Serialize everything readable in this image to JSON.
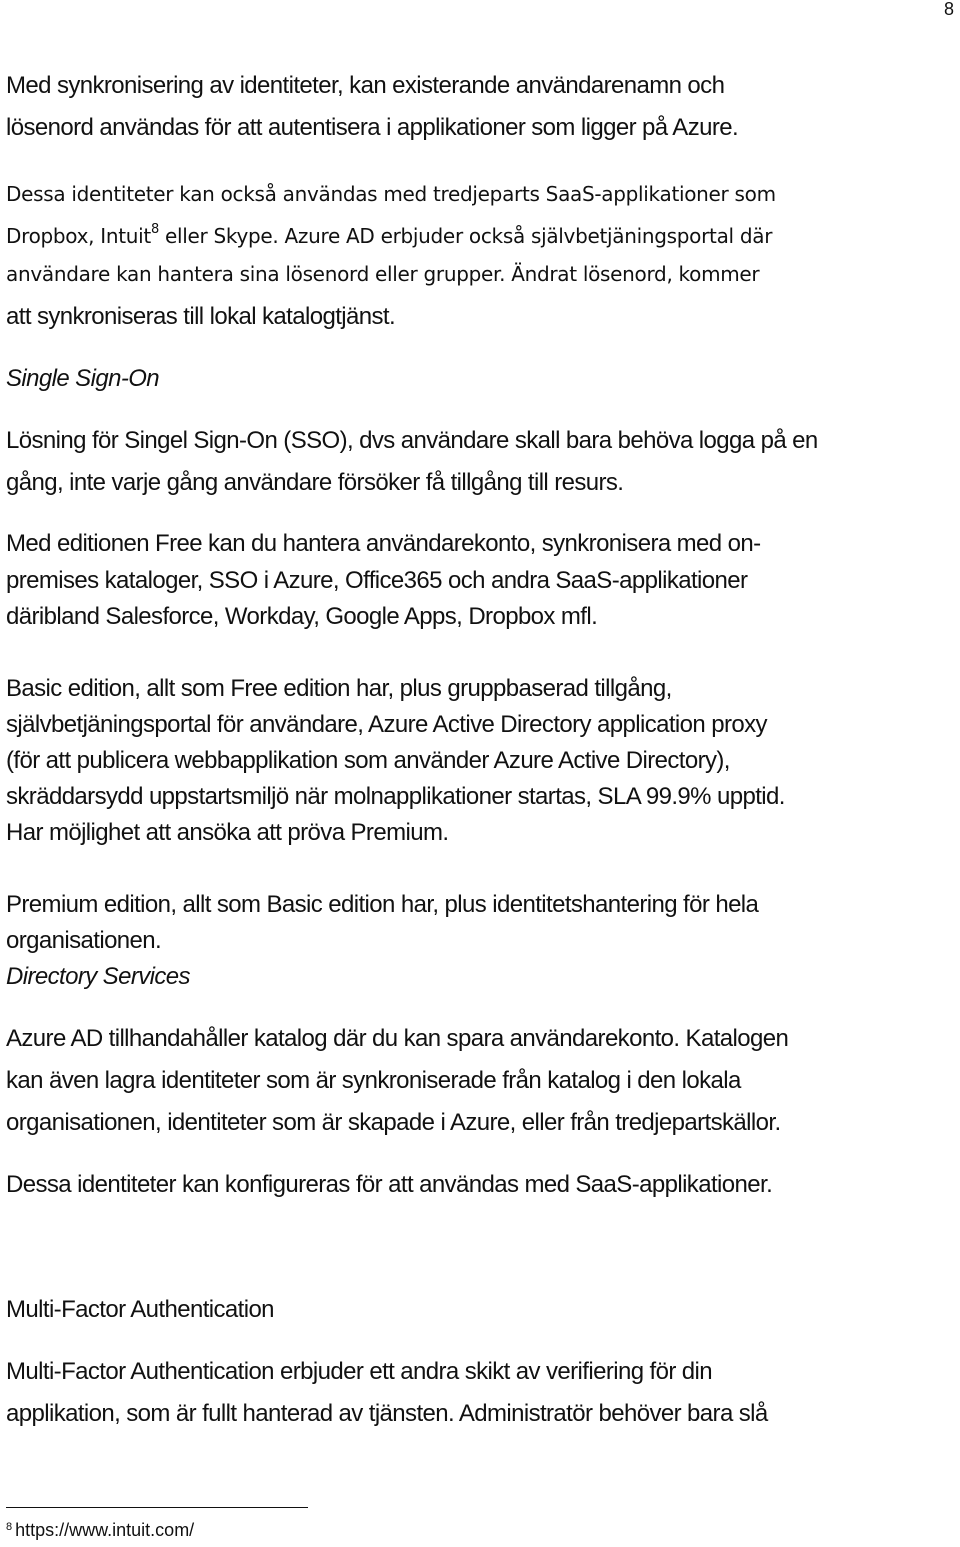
{
  "page": {
    "number": "8"
  },
  "paragraphs": {
    "sync_identities": [
      "Med synkronisering av identiteter, kan existerande användarenamn och",
      "lösenord användas för att autentisera i applikationer som ligger på Azure."
    ],
    "third_party": {
      "line1": "Dessa identiteter kan också användas med tredjeparts SaaS-applikationer som",
      "line2_before_ref": "Dropbox, Intuit",
      "footnote_ref": "8",
      "line2_after_ref": " eller Skype. Azure AD erbjuder också självbetjäningsportal där",
      "line3": "användare kan hantera sina lösenord eller grupper. Ändrat lösenord, kommer",
      "line4": "att synkroniseras till lokal katalogtjänst."
    },
    "sso_heading": "Single Sign-On",
    "sso": [
      "Lösning för Singel Sign-On (SSO), dvs användare skall bara behöva logga på en",
      "gång, inte varje gång användare försöker få tillgång till resurs."
    ],
    "free_edition": [
      "Med editionen Free kan du hantera användarekonto, synkronisera med on-",
      "premises kataloger, SSO i Azure, Office365 och andra SaaS-applikationer",
      "däribland Salesforce, Workday, Google Apps, Dropbox mfl."
    ],
    "basic_edition": [
      "Basic edition, allt som Free edition har, plus gruppbaserad tillgång,",
      "självbetjäningsportal för användare, Azure Active Directory  application proxy",
      "(för att publicera webbapplikation som använder Azure Active Directory),",
      "skräddarsydd uppstartsmiljö när molnapplikationer startas, SLA 99.9% upptid.",
      "Har möjlighet att ansöka att pröva Premium."
    ],
    "premium_edition": [
      "Premium edition, allt som Basic edition har, plus identitetshantering för hela",
      "organisationen."
    ],
    "directory_heading": "Directory Services",
    "directory": [
      "Azure AD tillhandahåller katalog där du kan spara användarekonto. Katalogen",
      "kan även lagra identiteter som är synkroniserade från katalog i den lokala",
      "organisationen, identiteter som är skapade i Azure, eller från tredjepartskällor."
    ],
    "saas_config": "Dessa identiteter kan konfigureras för att användas med SaaS-applikationer.",
    "mfa_heading": "Multi-Factor Authentication",
    "mfa": [
      "Multi-Factor Authentication erbjuder ett andra skikt av verifiering för din",
      "applikation, som är fullt hanterad av tjänsten. Administratör behöver bara slå"
    ]
  },
  "footnote": {
    "marker": "8",
    "text": "https://www.intuit.com/"
  }
}
